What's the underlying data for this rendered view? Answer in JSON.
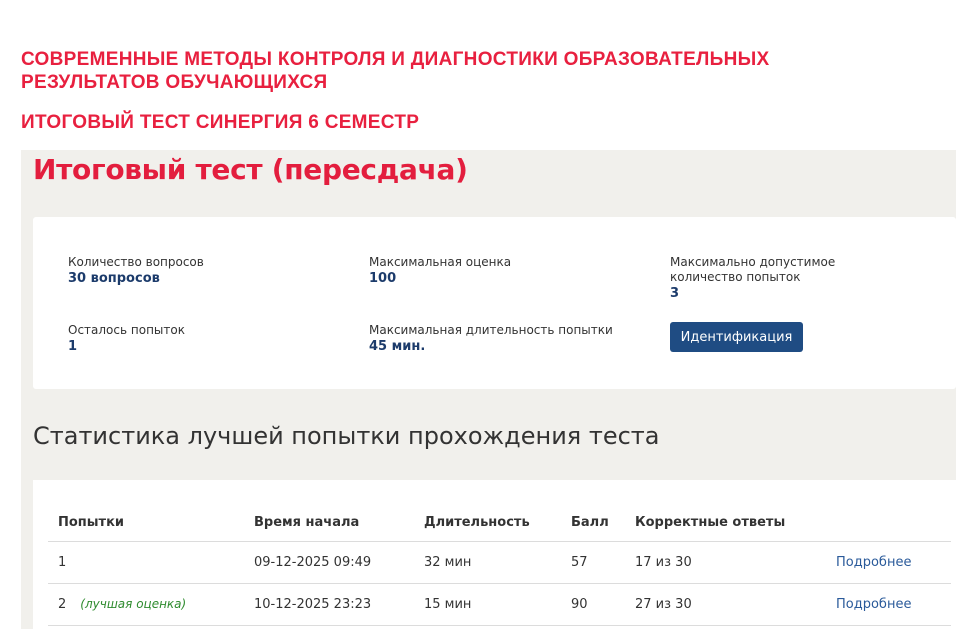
{
  "header": {
    "title": "СОВРЕМЕННЫЕ МЕТОДЫ КОНТРОЛЯ И ДИАГНОСТИКИ ОБРАЗОВАТЕЛЬНЫХ РЕЗУЛЬТАТОВ ОБУЧАЮЩИХСЯ",
    "subtitle": "ИТОГОВЫЙ ТЕСТ СИНЕРГИЯ 6 СЕМЕСТР"
  },
  "page": {
    "title": "Итоговый тест (пересдача)"
  },
  "info": {
    "questions_label": "Количество вопросов",
    "questions_value": "30 вопросов",
    "max_score_label": "Максимальная оценка",
    "max_score_value": "100",
    "max_attempts_label": "Максимально допустимое количество попыток",
    "max_attempts_value": "3",
    "remaining_label": "Осталось попыток",
    "remaining_value": "1",
    "max_duration_label": "Максимальная длительность попытки",
    "max_duration_value": "45 мин.",
    "identify_button": "Идентификация"
  },
  "stats": {
    "title": "Статистика лучшей попытки прохождения теста",
    "columns": [
      "Попытки",
      "Время начала",
      "Длительность",
      "Балл",
      "Корректные ответы"
    ],
    "rows": [
      {
        "attempt": "1",
        "note": "",
        "start": "09-12-2025 09:49",
        "duration": "32 мин",
        "score": "57",
        "correct": "17 из 30",
        "link": "Подробнее"
      },
      {
        "attempt": "2",
        "note": "(лучшая оценка)",
        "start": "10-12-2025 23:23",
        "duration": "15 мин",
        "score": "90",
        "correct": "27 из 30",
        "link": "Подробнее"
      }
    ]
  },
  "colors": {
    "accent_red": "#e31e3e",
    "button_blue": "#1f4c83",
    "value_blue": "#1c3b6b",
    "best_green": "#2e8b2e"
  }
}
